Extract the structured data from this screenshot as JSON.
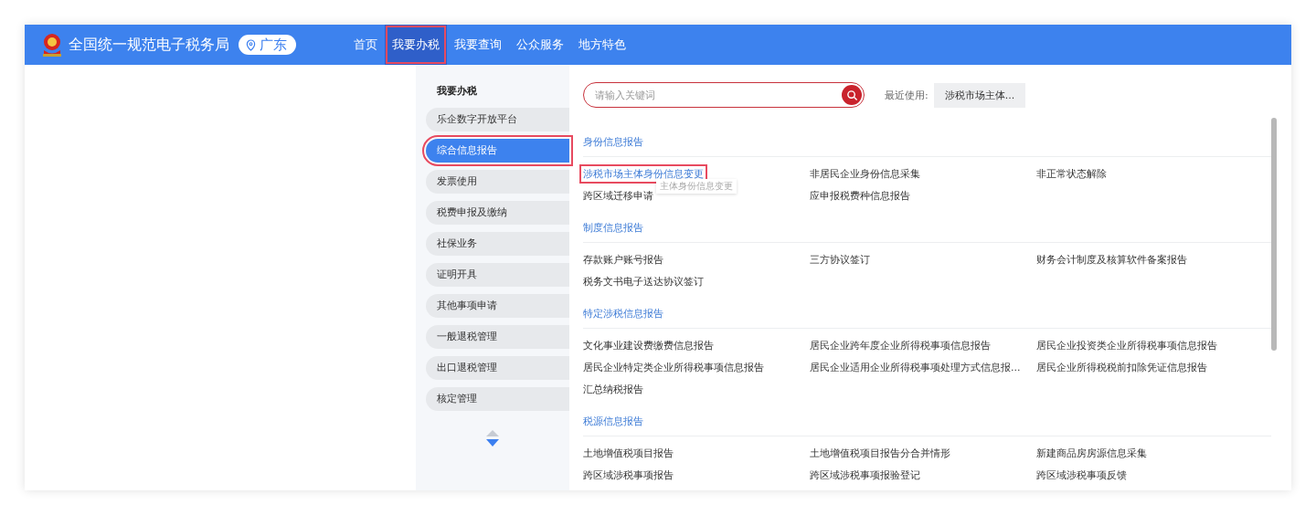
{
  "header": {
    "title": "全国统一规范电子税务局",
    "location": "广东",
    "nav": [
      {
        "label": "首页",
        "selected": false,
        "highlighted": false
      },
      {
        "label": "我要办税",
        "selected": true,
        "highlighted": true
      },
      {
        "label": "我要查询",
        "selected": false,
        "highlighted": false
      },
      {
        "label": "公众服务",
        "selected": false,
        "highlighted": false
      },
      {
        "label": "地方特色",
        "selected": false,
        "highlighted": false
      }
    ]
  },
  "sidebar": {
    "title": "我要办税",
    "items": [
      {
        "label": "乐企数字开放平台",
        "selected": false,
        "highlighted": false
      },
      {
        "label": "综合信息报告",
        "selected": true,
        "highlighted": true
      },
      {
        "label": "发票使用",
        "selected": false,
        "highlighted": false
      },
      {
        "label": "税费申报及缴纳",
        "selected": false,
        "highlighted": false
      },
      {
        "label": "社保业务",
        "selected": false,
        "highlighted": false
      },
      {
        "label": "证明开具",
        "selected": false,
        "highlighted": false
      },
      {
        "label": "其他事项申请",
        "selected": false,
        "highlighted": false
      },
      {
        "label": "一般退税管理",
        "selected": false,
        "highlighted": false
      },
      {
        "label": "出口退税管理",
        "selected": false,
        "highlighted": false
      },
      {
        "label": "核定管理",
        "selected": false,
        "highlighted": false
      }
    ]
  },
  "search": {
    "placeholder": "请输入关键词"
  },
  "recent": {
    "label": "最近使用:",
    "items": [
      "涉税市场主体..."
    ]
  },
  "sections": [
    {
      "title": "身份信息报告",
      "items": [
        {
          "label": "涉税市场主体身份信息变更",
          "highlighted": true,
          "tooltip": "主体身份信息变更"
        },
        {
          "label": "非居民企业身份信息采集",
          "highlighted": false
        },
        {
          "label": "非正常状态解除",
          "highlighted": false
        },
        {
          "label": "跨区域迁移申请",
          "highlighted": false
        },
        {
          "label": "应申报税费种信息报告",
          "highlighted": false
        }
      ]
    },
    {
      "title": "制度信息报告",
      "items": [
        {
          "label": "存款账户账号报告",
          "highlighted": false
        },
        {
          "label": "三方协议签订",
          "highlighted": false
        },
        {
          "label": "财务会计制度及核算软件备案报告",
          "highlighted": false
        },
        {
          "label": "税务文书电子送达协议签订",
          "highlighted": false
        }
      ]
    },
    {
      "title": "特定涉税信息报告",
      "items": [
        {
          "label": "文化事业建设费缴费信息报告",
          "highlighted": false
        },
        {
          "label": "居民企业跨年度企业所得税事项信息报告",
          "highlighted": false
        },
        {
          "label": "居民企业投资类企业所得税事项信息报告",
          "highlighted": false
        },
        {
          "label": "居民企业特定类企业所得税事项信息报告",
          "highlighted": false
        },
        {
          "label": "居民企业适用企业所得税事项处理方式信息报...",
          "highlighted": false
        },
        {
          "label": "居民企业所得税税前扣除凭证信息报告",
          "highlighted": false
        },
        {
          "label": "汇总纳税报告",
          "highlighted": false
        }
      ]
    },
    {
      "title": "税源信息报告",
      "items": [
        {
          "label": "土地增值税项目报告",
          "highlighted": false
        },
        {
          "label": "土地增值税项目报告分合并情形",
          "highlighted": false
        },
        {
          "label": "新建商品房房源信息采集",
          "highlighted": false
        },
        {
          "label": "跨区域涉税事项报告",
          "highlighted": false
        },
        {
          "label": "跨区域涉税事项报验登记",
          "highlighted": false
        },
        {
          "label": "跨区域涉税事项反馈",
          "highlighted": false
        }
      ]
    }
  ]
}
